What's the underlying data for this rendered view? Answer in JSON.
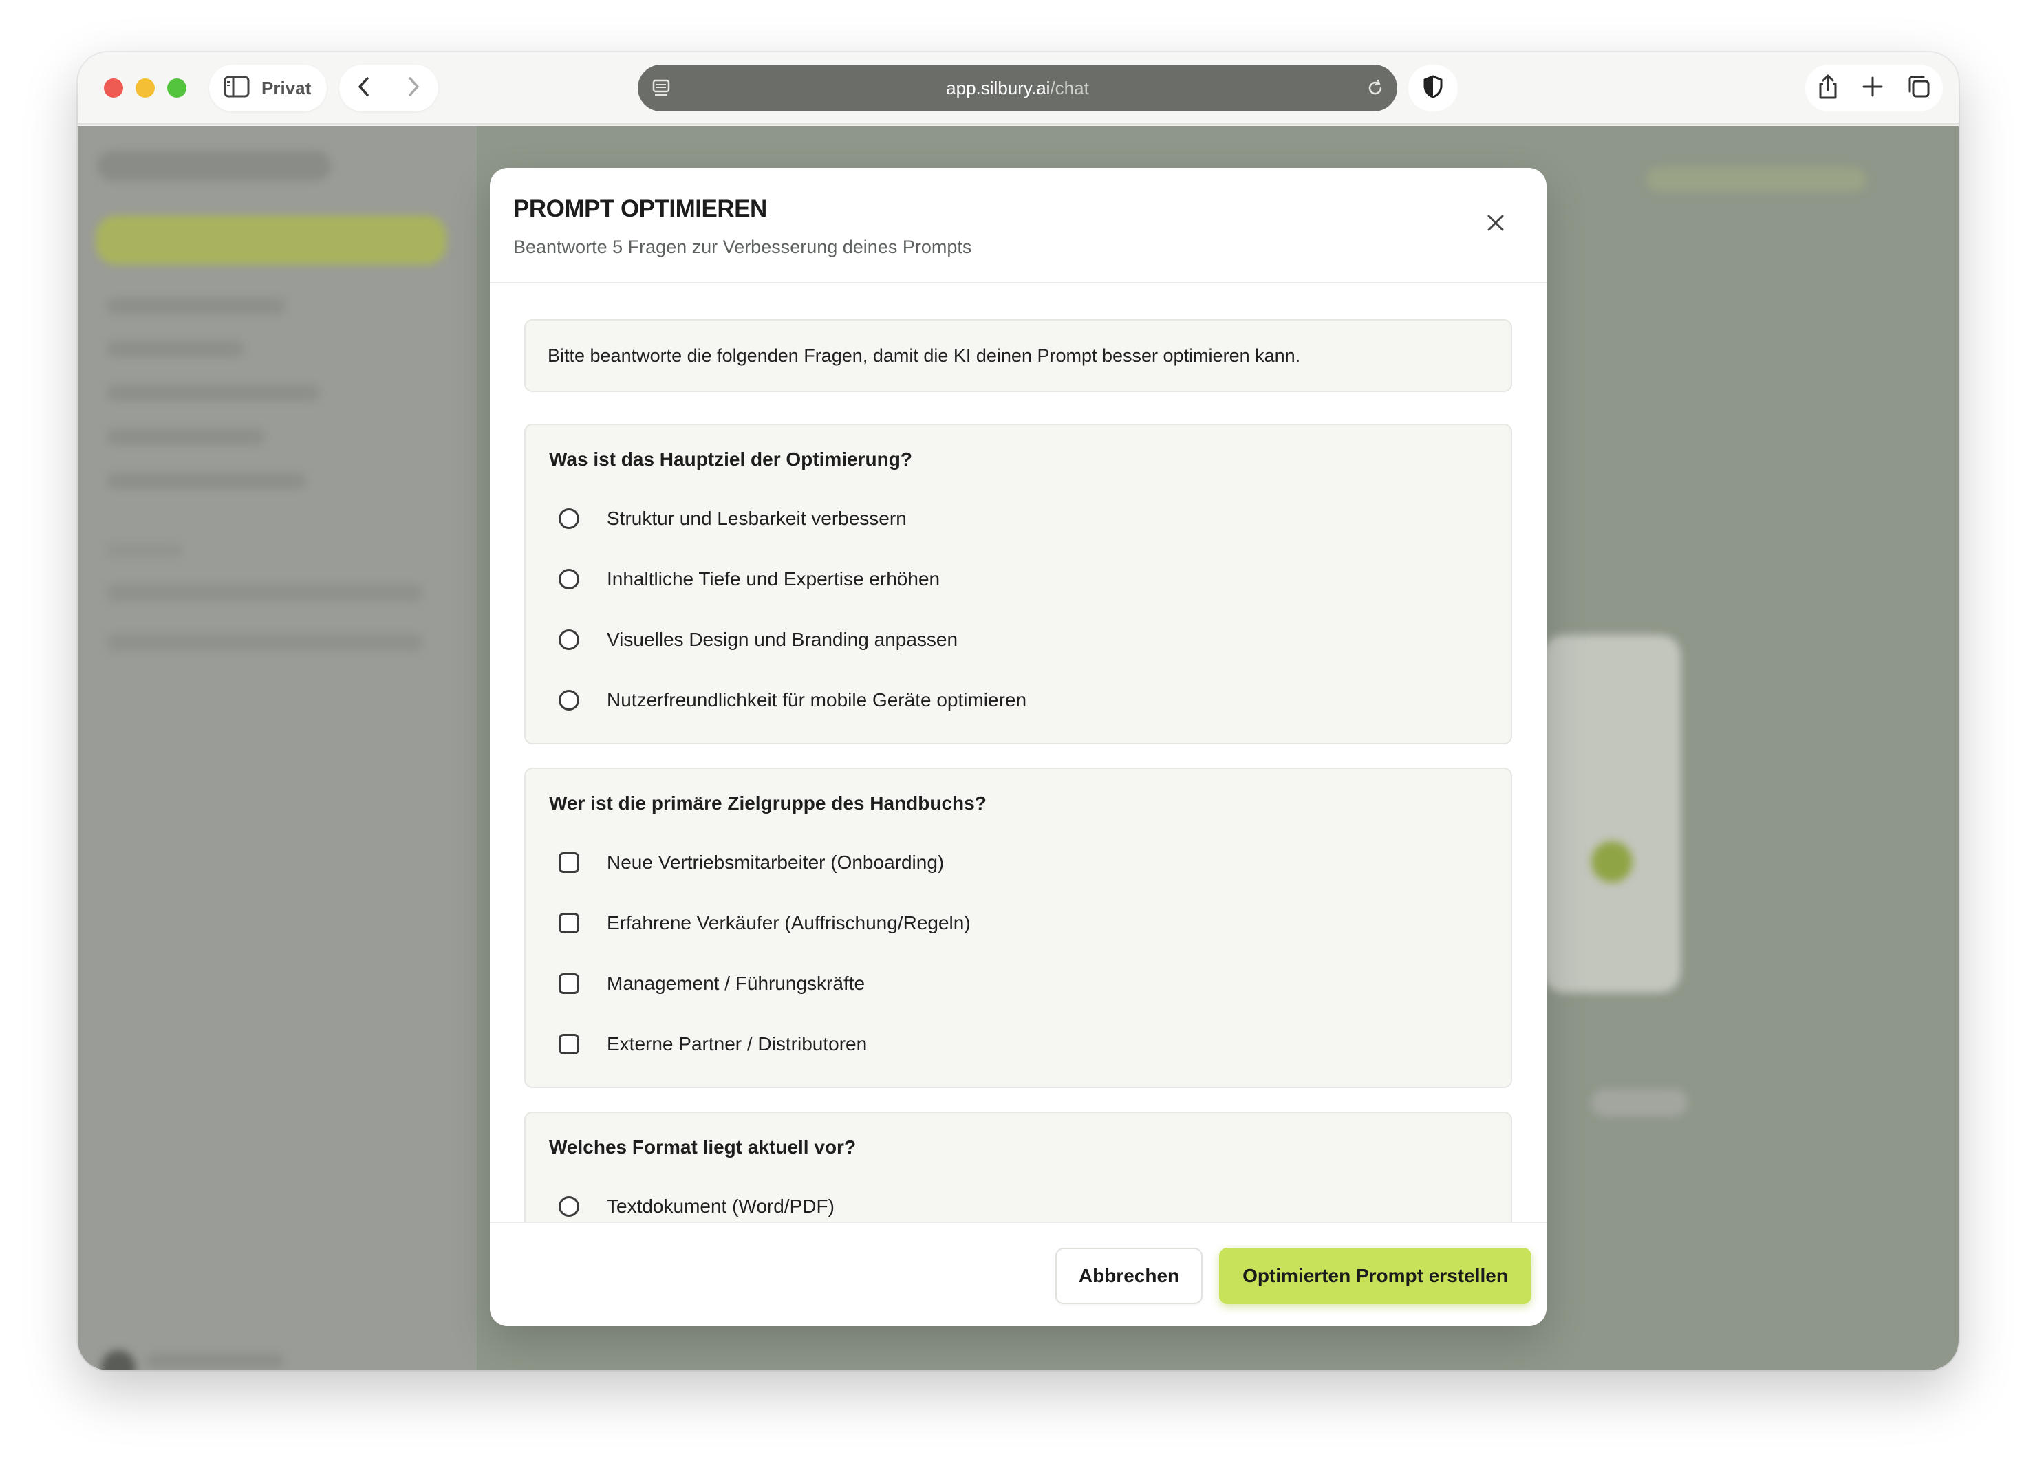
{
  "browser": {
    "profile_label": "Privat",
    "url_host": "app.silbury.ai",
    "url_path": "/chat"
  },
  "modal": {
    "title": "PROMPT OPTIMIEREN",
    "subtitle": "Beantworte 5 Fragen zur Verbesserung deines Prompts",
    "intro": "Bitte beantworte die folgenden Fragen, damit die KI deinen Prompt besser optimieren kann.",
    "questions": [
      {
        "title": "Was ist das Hauptziel der Optimierung?",
        "type": "radio",
        "options": [
          "Struktur und Lesbarkeit verbessern",
          "Inhaltliche Tiefe und Expertise erhöhen",
          "Visuelles Design und Branding anpassen",
          "Nutzerfreundlichkeit für mobile Geräte optimieren"
        ]
      },
      {
        "title": "Wer ist die primäre Zielgruppe des Handbuchs?",
        "type": "checkbox",
        "options": [
          "Neue Vertriebsmitarbeiter (Onboarding)",
          "Erfahrene Verkäufer (Auffrischung/Regeln)",
          "Management / Führungskräfte",
          "Externe Partner / Distributoren"
        ]
      },
      {
        "title": "Welches Format liegt aktuell vor?",
        "type": "radio",
        "options": [
          "Textdokument (Word/PDF)"
        ]
      }
    ],
    "cancel_label": "Abbrechen",
    "submit_label": "Optimierten Prompt erstellen"
  },
  "icons": {
    "sidebar_toggle": "sidebar-icon",
    "back": "chevron-left-icon",
    "forward": "chevron-right-icon",
    "reader": "reader-icon",
    "reload": "reload-icon",
    "shield": "shield-icon",
    "share": "share-icon",
    "new_tab": "plus-icon",
    "tabs": "tabs-overview-icon",
    "close": "close-icon"
  },
  "colors": {
    "accent": "#c8e35a",
    "url_bar": "#6b6d68",
    "traffic_red": "#ee5b52",
    "traffic_yellow": "#f4be35",
    "traffic_green": "#54c43f"
  }
}
